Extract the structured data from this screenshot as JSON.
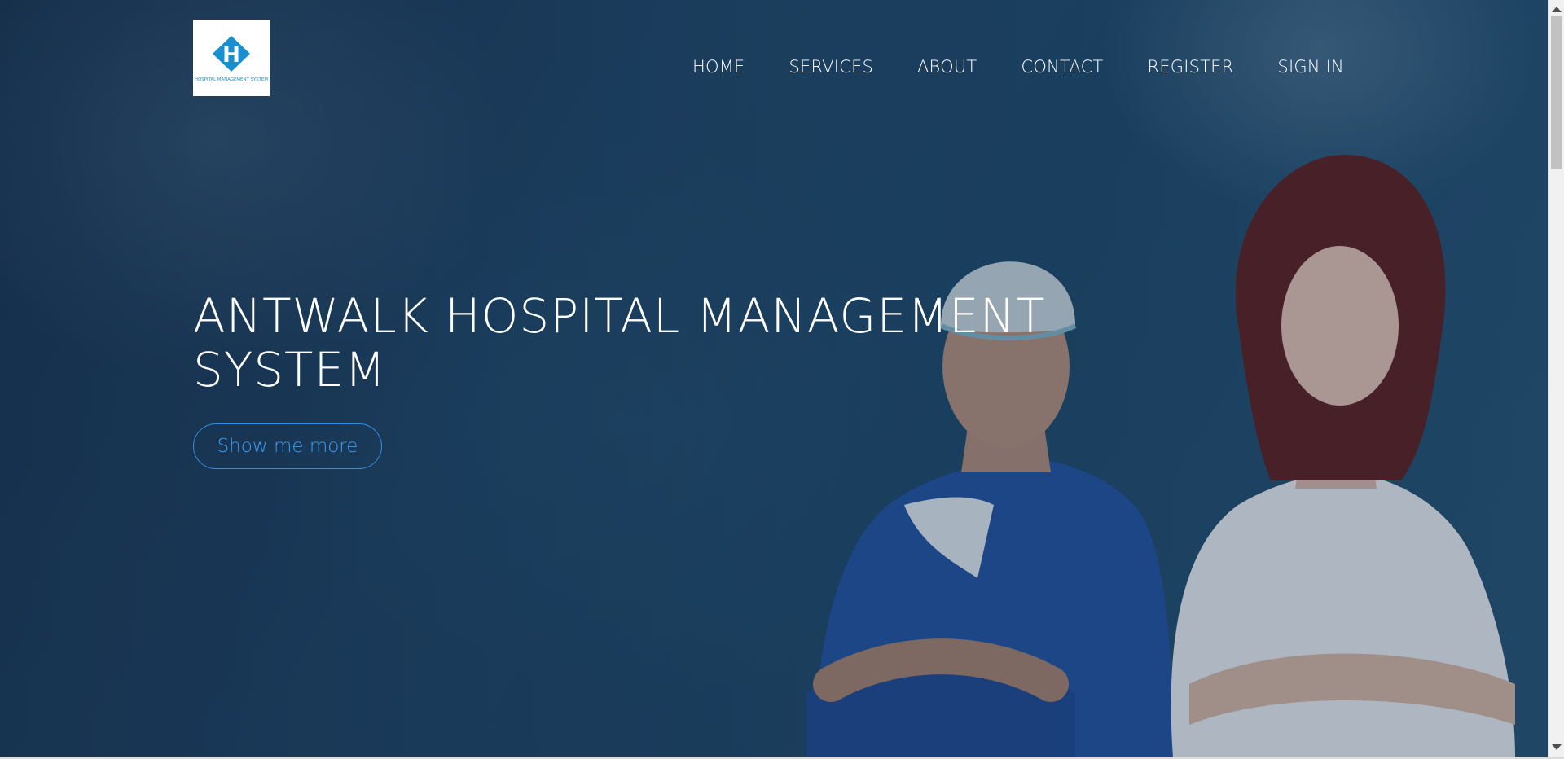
{
  "header": {
    "logo": {
      "letter": "H",
      "caption": "HOSPITAL MANAGEMENT SYSTEM",
      "icon": "hospital-h-logo-icon",
      "color": "#1a8fd0"
    },
    "nav": [
      {
        "label": "HOME"
      },
      {
        "label": "SERVICES"
      },
      {
        "label": "ABOUT"
      },
      {
        "label": "CONTACT"
      },
      {
        "label": "REGISTER"
      },
      {
        "label": "SIGN IN"
      }
    ]
  },
  "hero": {
    "title": "ANTWALK HOSPITAL MANAGEMENT SYSTEM",
    "cta_label": "Show me more",
    "accent_color": "#3b9cf2",
    "background_color": "#1f4465"
  },
  "scrollbar": {
    "up_icon": "scroll-up-arrow-icon",
    "down_icon": "scroll-down-arrow-icon"
  }
}
